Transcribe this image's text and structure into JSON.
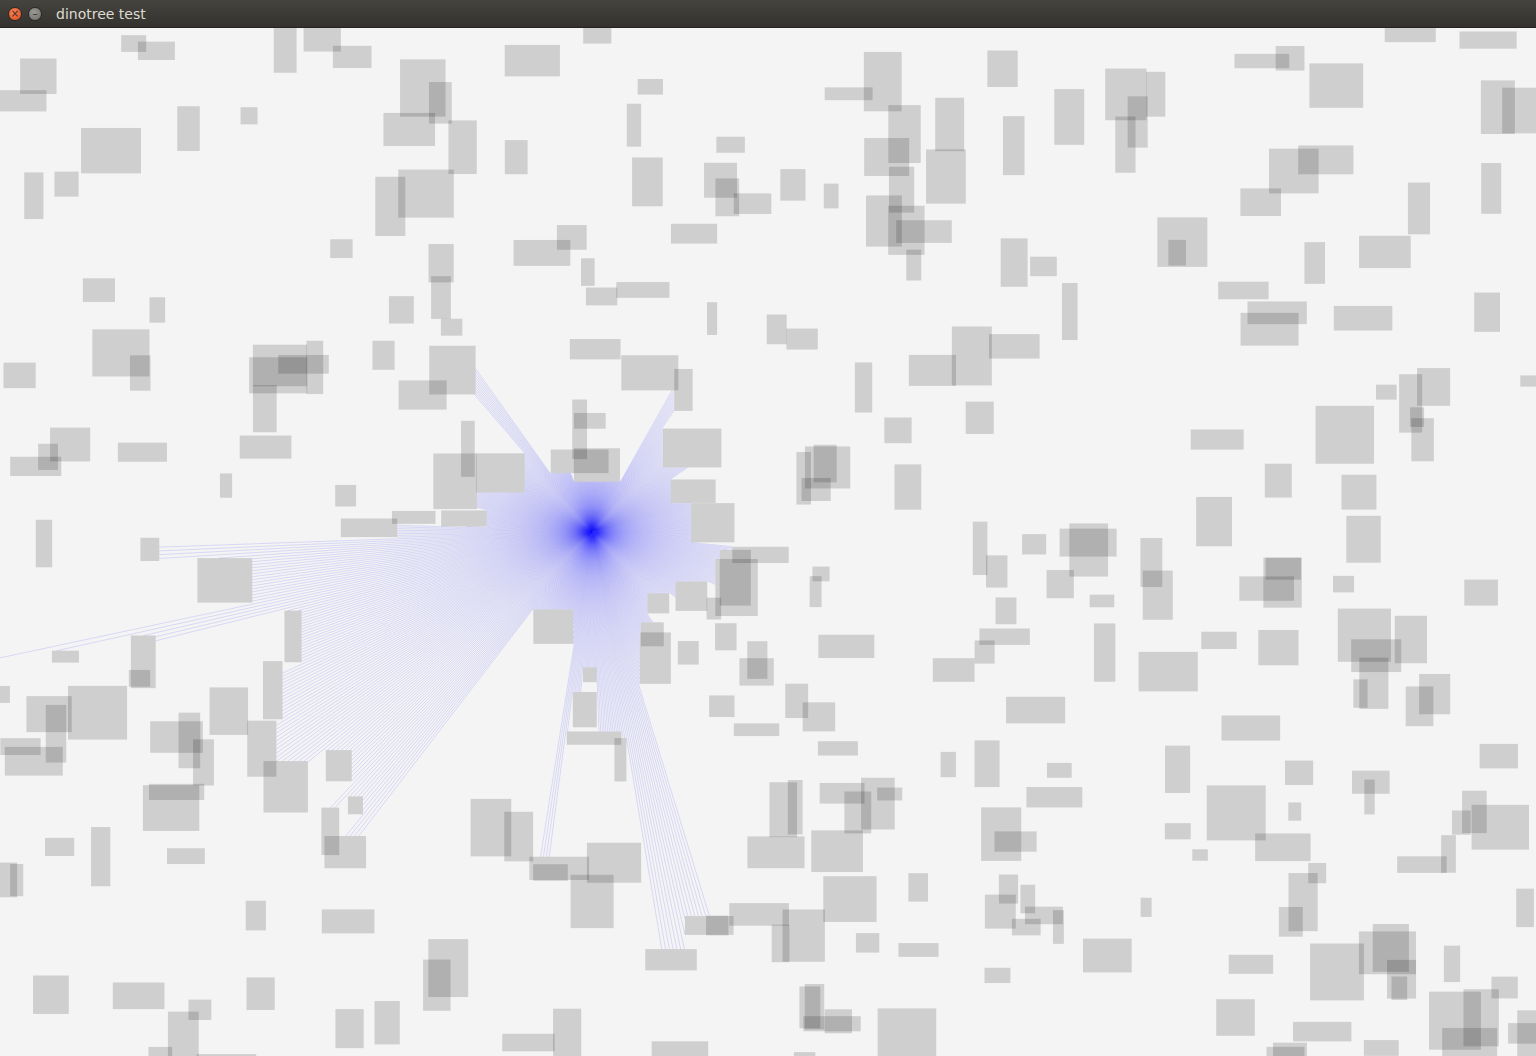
{
  "window": {
    "title": "dinotree test",
    "controls": [
      {
        "kind": "close",
        "label": "×"
      },
      {
        "kind": "minimize",
        "label": "–"
      }
    ]
  },
  "scene": {
    "rectangles": 330,
    "rays": 720
  }
}
